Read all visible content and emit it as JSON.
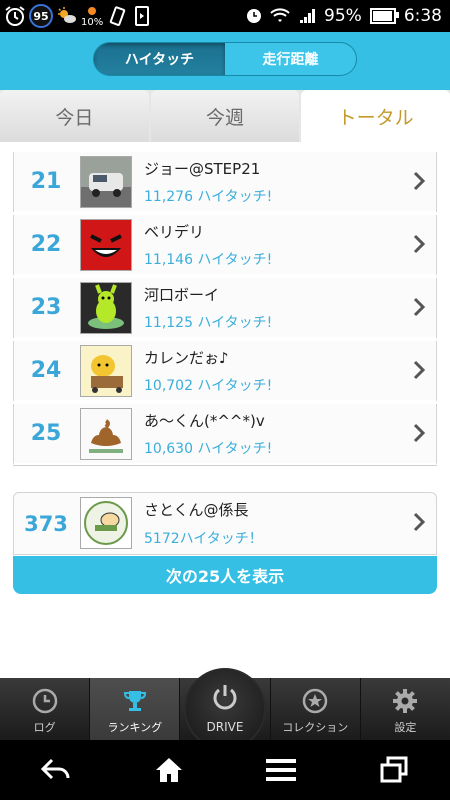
{
  "status_bar": {
    "badge": "95",
    "data_percent": "10%",
    "battery_percent": "95%",
    "time": "6:38"
  },
  "header": {
    "segments": [
      {
        "label": "ハイタッチ",
        "active": true
      },
      {
        "label": "走行距離",
        "active": false
      }
    ]
  },
  "tabs": [
    {
      "label": "今日",
      "active": false
    },
    {
      "label": "今週",
      "active": false
    },
    {
      "label": "トータル",
      "active": true
    }
  ],
  "ranking": [
    {
      "rank": "21",
      "name": "ジョー@STEP21",
      "score": "11,276 ハイタッチ!",
      "avatar": "car-photo"
    },
    {
      "rank": "22",
      "name": "ベリデリ",
      "score": "11,146 ハイタッチ!",
      "avatar": "red-smile"
    },
    {
      "rank": "23",
      "name": "河口ボーイ",
      "score": "11,125 ハイタッチ!",
      "avatar": "green-figure"
    },
    {
      "rank": "24",
      "name": "カレンだぉ♪",
      "score": "10,702 ハイタッチ!",
      "avatar": "yellow-character"
    },
    {
      "rank": "25",
      "name": "あ～くん(*^^*)v",
      "score": "10,630 ハイタッチ!",
      "avatar": "brown-swirl"
    }
  ],
  "my_rank": {
    "rank": "373",
    "name": "さとくん@係長",
    "score": "5172ハイタッチ！",
    "avatar": "stamp-drawing"
  },
  "more_button": "次の25人を表示",
  "bottom_nav": {
    "items": [
      {
        "label": "ログ",
        "icon": "clock-icon",
        "active": false
      },
      {
        "label": "ランキング",
        "icon": "trophy-icon",
        "active": true
      },
      {
        "label": "DRIVE",
        "icon": "power-icon",
        "active": false
      },
      {
        "label": "コレクション",
        "icon": "star-circle-icon",
        "active": false
      },
      {
        "label": "設定",
        "icon": "gear-icon",
        "active": false
      }
    ]
  },
  "colors": {
    "accent": "#35bfe4",
    "rank_blue": "#3aa7d8",
    "active_tab_text": "#c49a2a"
  }
}
